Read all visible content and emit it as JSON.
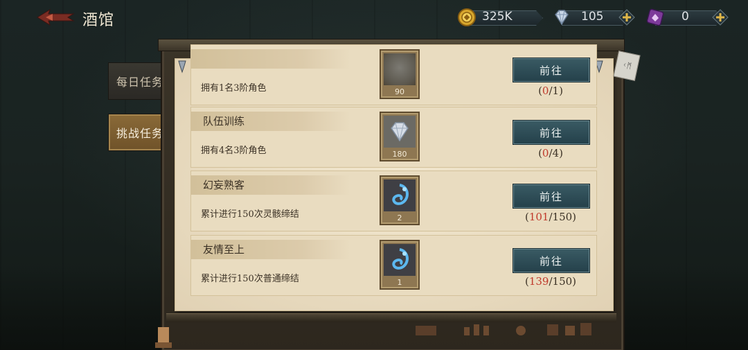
{
  "header": {
    "title": "酒馆",
    "resources": [
      {
        "name": "gold",
        "value": "325K",
        "icon": "coin-icon"
      },
      {
        "name": "diamond",
        "value": "105",
        "icon": "diamond-icon"
      },
      {
        "name": "ticket",
        "value": "0",
        "icon": "purple-ticket-icon"
      }
    ]
  },
  "tabs": [
    {
      "label": "每日任务",
      "active": false
    },
    {
      "label": "挑战任务",
      "active": true
    }
  ],
  "tasks": [
    {
      "name": "",
      "desc": "拥有1名3阶角色",
      "reward": "90",
      "button": "前往",
      "progress_current": "0",
      "progress_total": "1"
    },
    {
      "name": "队伍训练",
      "desc": "拥有4名3阶角色",
      "reward": "180",
      "button": "前往",
      "progress_current": "0",
      "progress_total": "4"
    },
    {
      "name": "幻妄熟客",
      "desc": "累计进行150次灵骸缔结",
      "reward": "2",
      "button": "前往",
      "progress_current": "101",
      "progress_total": "150"
    },
    {
      "name": "友情至上",
      "desc": "累计进行150次普通缔结",
      "reward": "1",
      "button": "前往",
      "progress_current": "139",
      "progress_total": "150"
    }
  ],
  "colors": {
    "accent_red": "#c0392b",
    "tab_active": "#7a5b2e",
    "button": "#2f4d57"
  }
}
